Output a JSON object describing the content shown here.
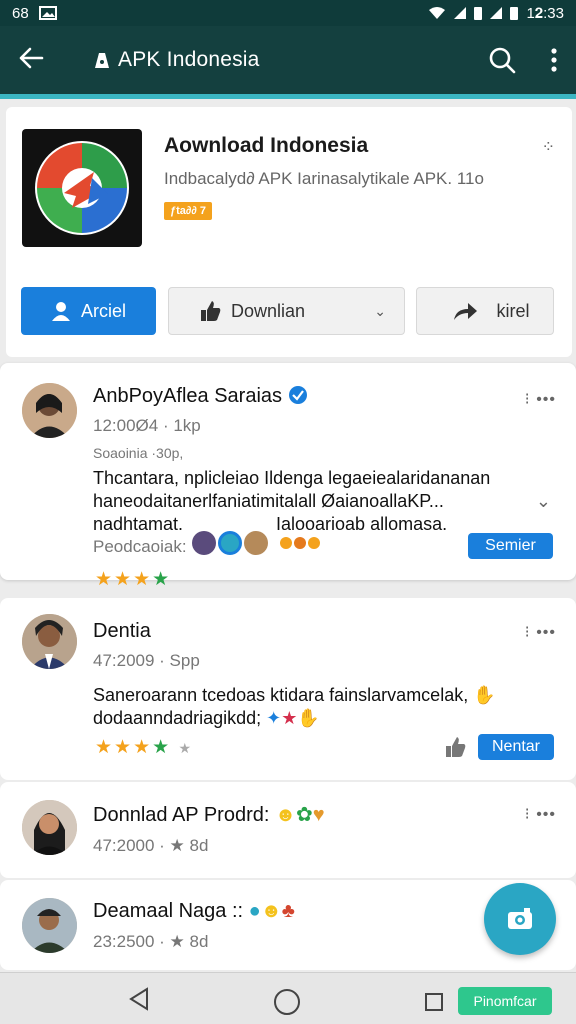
{
  "status_bar": {
    "left_text": "68",
    "time": "1𝟐:33"
  },
  "app_bar": {
    "title": "APK Indonesia"
  },
  "app": {
    "title": "Aownload Indonesia",
    "subtitle": "Indbacalyd∂ APK Iarinasalytikale APK. 11o",
    "badge": "ƒta∂∂ 7",
    "buttons": {
      "primary": "Arciel",
      "download": "Downlian",
      "share": "kirel"
    }
  },
  "reviews": [
    {
      "name": "AnbPoyAflea Saraias",
      "meta1": "12:00Ø4 · 1kp",
      "meta2": "Soaoinia ·30p,",
      "text1": "Thcantara, nplicleiao Ildenga legaeiealaridananan",
      "text2": "haneodaitanerlfaniatimitalall ØaianoallaKP...",
      "text3": "nadhtamat.",
      "text3b": "Ialooarioab allomasa.",
      "footer": "Peodcaoiak:",
      "pill": "Semier"
    },
    {
      "name": "Dentia",
      "meta": "47:2009 · Spp",
      "text1": "Saneroarann tcedoas ktidara fainslarvamcelak,",
      "text2": "dodaanndadriagikdd;",
      "pill": "Nentar"
    },
    {
      "name": "Donnlad AP Prodrd:",
      "meta": "47:2000 · ★ 8d"
    },
    {
      "name": "Deamaal Naga ::",
      "meta": "23:2500 · ★ 8d"
    }
  ],
  "nav": {
    "pill": "Pinomfcar"
  },
  "colors": {
    "appbar": "#14403f",
    "accent": "#3bb6c2",
    "primary": "#1a7fdc",
    "fab": "#2aa6c4",
    "star": "#f4a21d"
  },
  "icons": [
    "back-arrow-icon",
    "apk-logo-icon",
    "search-icon",
    "more-vert-icon",
    "user-icon",
    "thumb-icon",
    "share-arrow-icon",
    "verified-icon",
    "camera-icon"
  ]
}
